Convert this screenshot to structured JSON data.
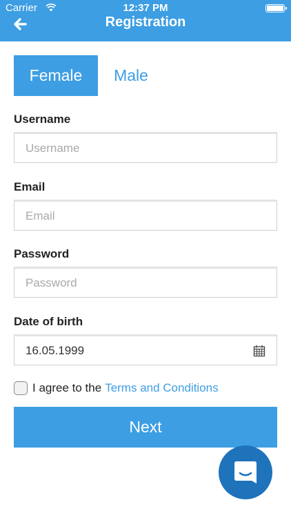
{
  "status_bar": {
    "carrier": "Carrier",
    "time": "12:37 PM"
  },
  "header": {
    "title": "Registration",
    "back_icon": "arrow-left-icon"
  },
  "gender": {
    "female": "Female",
    "male": "Male",
    "selected": "Female"
  },
  "form": {
    "username": {
      "label": "Username",
      "placeholder": "Username",
      "value": ""
    },
    "email": {
      "label": "Email",
      "placeholder": "Email",
      "value": ""
    },
    "password": {
      "label": "Password",
      "placeholder": "Password",
      "value": ""
    },
    "dob": {
      "label": "Date of birth",
      "value": "16.05.1999",
      "icon": "calendar-icon"
    }
  },
  "agree": {
    "text": "I agree to the",
    "link": "Terms and Conditions",
    "checked": false
  },
  "next_label": "Next",
  "colors": {
    "accent": "#3d9ee3",
    "chat": "#1e73bb"
  }
}
